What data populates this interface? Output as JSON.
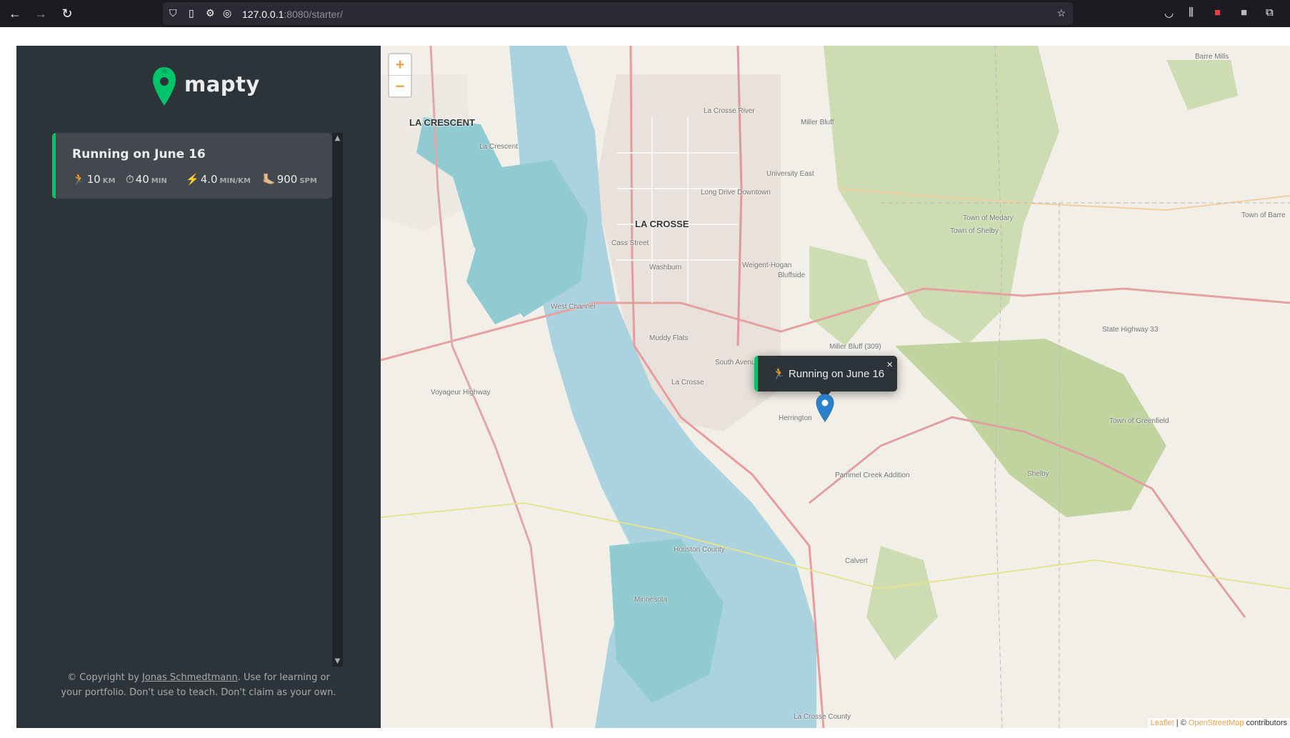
{
  "browser": {
    "url_host": "127.0.0.1",
    "url_rest": ":8080/starter/"
  },
  "app": {
    "logo_text": "mapty",
    "accent_color": "#00c46a"
  },
  "workouts": [
    {
      "title": "Running on June 16",
      "type": "running",
      "details": [
        {
          "icon": "🏃",
          "value": "10",
          "unit": "km"
        },
        {
          "icon": "⏱",
          "value": "40",
          "unit": "min"
        },
        {
          "icon": "⚡️",
          "value": "4.0",
          "unit": "min/km"
        },
        {
          "icon": "🦶🏼",
          "value": "900",
          "unit": "spm"
        }
      ]
    }
  ],
  "copyright": {
    "prefix": "© Copyright by ",
    "author": "Jonas Schmedtmann",
    "suffix": ". Use for learning or your portfolio. Don't use to teach. Don't claim as your own."
  },
  "map": {
    "zoom_in": "+",
    "zoom_out": "−",
    "popup_icon": "🏃",
    "popup_text": "Running on June 16",
    "popup_close": "×",
    "attribution_leaflet": "Leaflet",
    "attribution_sep": " | © ",
    "attribution_osm": "OpenStreetMap",
    "attribution_suffix": " contributors",
    "labels": [
      "LA CRESCENT",
      "La Crescent",
      "LA CROSSE",
      "Cass Street",
      "Washburn",
      "Weigent-Hogan",
      "Miller Bluff",
      "University East",
      "Town of Medary",
      "Town of Shelby",
      "Town of Barre",
      "Barre Mills",
      "State Highway 33",
      "Miller Bluff (309)",
      "South Avenue",
      "La Crosse",
      "Herrington",
      "Muddy Flats",
      "Pammel Creek Addition",
      "Shelby",
      "Voyageur Highway",
      "Houston County",
      "Minnesota",
      "La Crosse County",
      "Town of Greenfield",
      "Calvert",
      "Bluffside",
      "Long Drive Downtown",
      "West Channel",
      "La Crosse River"
    ]
  }
}
